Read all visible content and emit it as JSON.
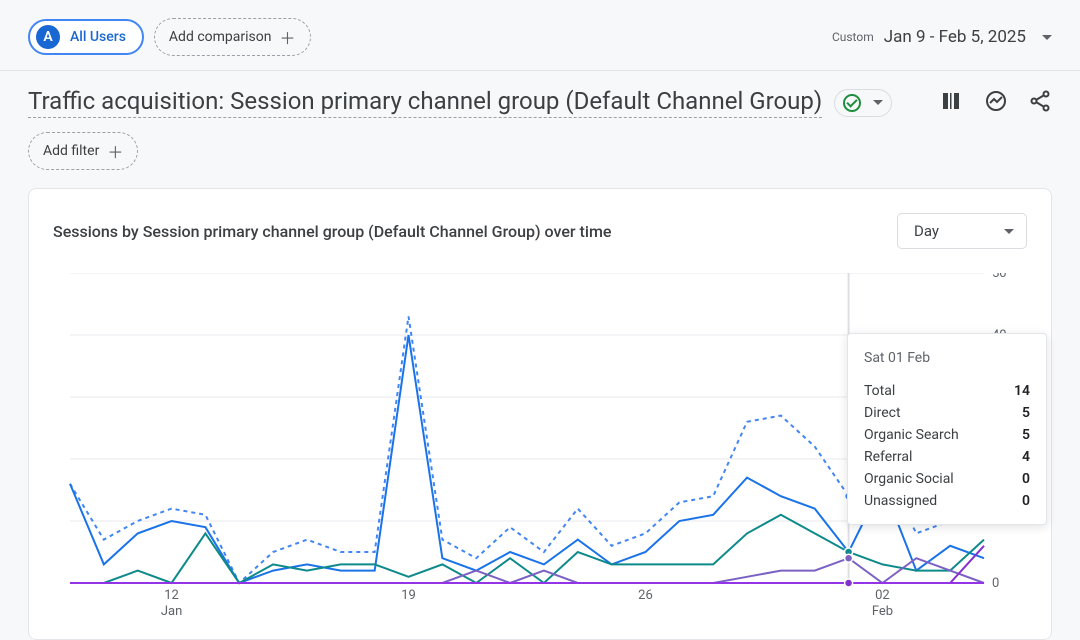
{
  "header": {
    "all_users_label": "All Users",
    "all_users_avatar": "A",
    "add_comparison_label": "Add comparison",
    "custom_label": "Custom",
    "date_range": "Jan 9 - Feb 5, 2025"
  },
  "title": "Traffic acquisition: Session primary channel group (Default Channel Group)",
  "add_filter_label": "Add filter",
  "card": {
    "title": "Sessions by Session primary channel group (Default Channel Group) over time",
    "granularity": "Day"
  },
  "tooltip": {
    "date": "Sat 01 Feb",
    "rows": [
      {
        "label": "Total",
        "value": 14
      },
      {
        "label": "Direct",
        "value": 5
      },
      {
        "label": "Organic Search",
        "value": 5
      },
      {
        "label": "Referral",
        "value": 4
      },
      {
        "label": "Organic Social",
        "value": 0
      },
      {
        "label": "Unassigned",
        "value": 0
      }
    ]
  },
  "chart_data": {
    "type": "line",
    "title": "Sessions by Session primary channel group (Default Channel Group) over time",
    "xlabel": "",
    "ylabel": "",
    "ylim": [
      0,
      50
    ],
    "x": [
      "Jan 09",
      "Jan 10",
      "Jan 11",
      "Jan 12",
      "Jan 13",
      "Jan 14",
      "Jan 15",
      "Jan 16",
      "Jan 17",
      "Jan 18",
      "Jan 19",
      "Jan 20",
      "Jan 21",
      "Jan 22",
      "Jan 23",
      "Jan 24",
      "Jan 25",
      "Jan 26",
      "Jan 27",
      "Jan 28",
      "Jan 29",
      "Jan 30",
      "Jan 31",
      "Feb 01",
      "Feb 02",
      "Feb 03",
      "Feb 04",
      "Feb 05"
    ],
    "x_ticks": [
      {
        "index": 3,
        "label": "12",
        "sublabel": "Jan"
      },
      {
        "index": 10,
        "label": "19"
      },
      {
        "index": 17,
        "label": "26"
      },
      {
        "index": 24,
        "label": "02",
        "sublabel": "Feb"
      }
    ],
    "y_ticks": [
      0,
      10,
      20,
      30,
      40,
      50
    ],
    "hover_index": 23,
    "series": [
      {
        "name": "Total",
        "style": "dotted-area",
        "color": "#4285f4",
        "values": [
          16,
          7,
          10,
          12,
          11,
          0,
          5,
          7,
          5,
          5,
          43,
          7,
          4,
          9,
          5,
          12,
          6,
          8,
          13,
          14,
          26,
          27,
          22,
          14,
          19,
          8,
          10,
          10
        ]
      },
      {
        "name": "Direct",
        "style": "line",
        "color": "#1a73e8",
        "values": [
          16,
          3,
          8,
          10,
          9,
          0,
          2,
          3,
          2,
          2,
          40,
          4,
          2,
          5,
          3,
          7,
          3,
          5,
          10,
          11,
          17,
          14,
          12,
          5,
          16,
          2,
          6,
          4
        ]
      },
      {
        "name": "Organic Search",
        "style": "line",
        "color": "#0f8a8a",
        "values": [
          0,
          0,
          2,
          0,
          8,
          0,
          3,
          2,
          3,
          3,
          1,
          3,
          0,
          4,
          0,
          5,
          3,
          3,
          3,
          3,
          8,
          11,
          8,
          5,
          3,
          2,
          2,
          7
        ]
      },
      {
        "name": "Referral",
        "style": "line",
        "color": "#7b61c4",
        "values": [
          0,
          0,
          0,
          0,
          0,
          0,
          0,
          0,
          0,
          0,
          0,
          0,
          2,
          0,
          2,
          0,
          0,
          0,
          0,
          0,
          1,
          2,
          2,
          4,
          0,
          4,
          2,
          0
        ]
      },
      {
        "name": "Organic Social",
        "style": "line",
        "color": "#8430ce",
        "values": [
          0,
          0,
          0,
          0,
          0,
          0,
          0,
          0,
          0,
          0,
          0,
          0,
          0,
          0,
          0,
          0,
          0,
          0,
          0,
          0,
          0,
          0,
          0,
          0,
          0,
          0,
          0,
          6
        ]
      },
      {
        "name": "Unassigned",
        "style": "line",
        "color": "#9334e6",
        "values": [
          0,
          0,
          0,
          0,
          0,
          0,
          0,
          0,
          0,
          0,
          0,
          0,
          0,
          0,
          0,
          0,
          0,
          0,
          0,
          0,
          0,
          0,
          0,
          0,
          0,
          0,
          0,
          0
        ]
      }
    ]
  }
}
